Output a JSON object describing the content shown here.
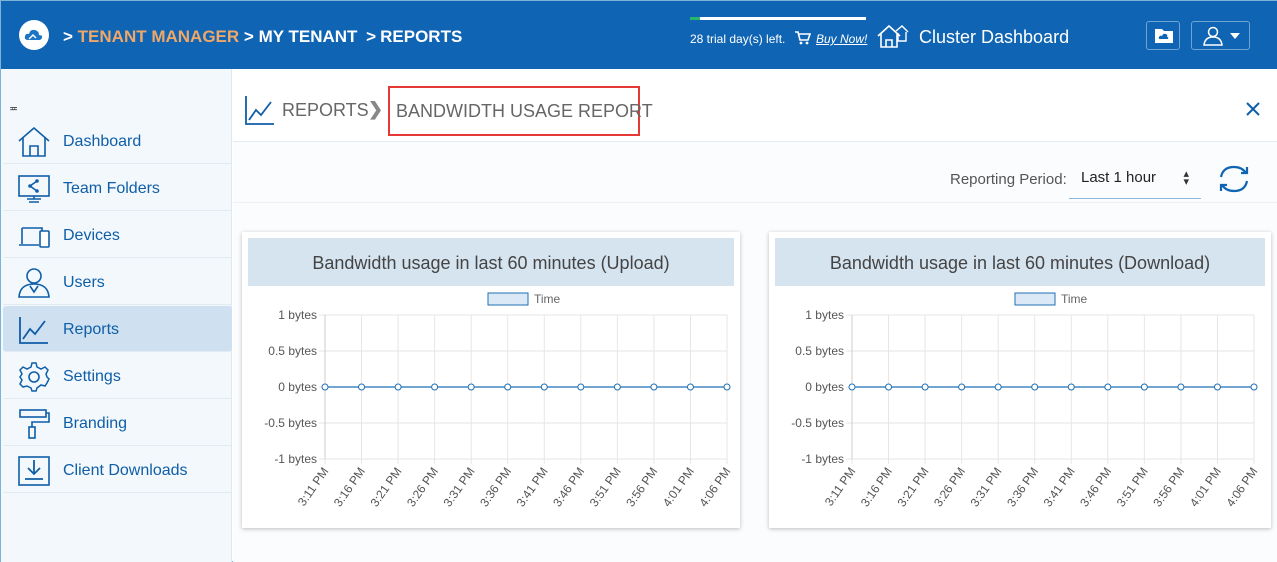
{
  "topbar": {
    "breadcrumb": [
      ">",
      "TENANT MANAGER",
      ">",
      "MY TENANT",
      ">",
      "REPORTS"
    ],
    "trial_text": "28 trial day(s) left.",
    "buy_label": "Buy Now!",
    "cluster_label": "Cluster Dashboard"
  },
  "sidebar": {
    "collapse_glyph": "≖",
    "items": [
      {
        "label": "Dashboard",
        "icon": "home-icon"
      },
      {
        "label": "Team Folders",
        "icon": "team-folder-icon"
      },
      {
        "label": "Devices",
        "icon": "devices-icon"
      },
      {
        "label": "Users",
        "icon": "user-icon"
      },
      {
        "label": "Reports",
        "icon": "reports-icon",
        "active": true
      },
      {
        "label": "Settings",
        "icon": "gear-icon"
      },
      {
        "label": "Branding",
        "icon": "paint-roller-icon"
      },
      {
        "label": "Client Downloads",
        "icon": "download-icon"
      }
    ]
  },
  "header": {
    "section": "REPORTS",
    "title": "BANDWIDTH USAGE REPORT"
  },
  "filter": {
    "label": "Reporting Period:",
    "value": "Last 1 hour"
  },
  "colors": {
    "topbar": "#0f64b3",
    "tenant_manager": "#f0a868",
    "line": "#1f6fb4",
    "highlight": "#e53935"
  },
  "chart_data": [
    {
      "type": "line",
      "title": "Bandwidth usage in last 60 minutes (Upload)",
      "legend": [
        "Time"
      ],
      "legend_placement": "top-center",
      "grid": true,
      "x": [
        "3:11 PM",
        "3:16 PM",
        "3:21 PM",
        "3:26 PM",
        "3:31 PM",
        "3:36 PM",
        "3:41 PM",
        "3:46 PM",
        "3:51 PM",
        "3:56 PM",
        "4:01 PM",
        "4:06 PM"
      ],
      "series": [
        {
          "name": "Time",
          "values": [
            0,
            0,
            0,
            0,
            0,
            0,
            0,
            0,
            0,
            0,
            0,
            0
          ]
        }
      ],
      "yticks": [
        "1 bytes",
        "0.5 bytes",
        "0 bytes",
        "-0.5 bytes",
        "-1 bytes"
      ],
      "ylim": [
        -1,
        1
      ]
    },
    {
      "type": "line",
      "title": "Bandwidth usage in last 60 minutes (Download)",
      "legend": [
        "Time"
      ],
      "legend_placement": "top-center",
      "grid": true,
      "x": [
        "3:11 PM",
        "3:16 PM",
        "3:21 PM",
        "3:26 PM",
        "3:31 PM",
        "3:36 PM",
        "3:41 PM",
        "3:46 PM",
        "3:51 PM",
        "3:56 PM",
        "4:01 PM",
        "4:06 PM"
      ],
      "series": [
        {
          "name": "Time",
          "values": [
            0,
            0,
            0,
            0,
            0,
            0,
            0,
            0,
            0,
            0,
            0,
            0
          ]
        }
      ],
      "yticks": [
        "1 bytes",
        "0.5 bytes",
        "0 bytes",
        "-0.5 bytes",
        "-1 bytes"
      ],
      "ylim": [
        -1,
        1
      ]
    }
  ]
}
